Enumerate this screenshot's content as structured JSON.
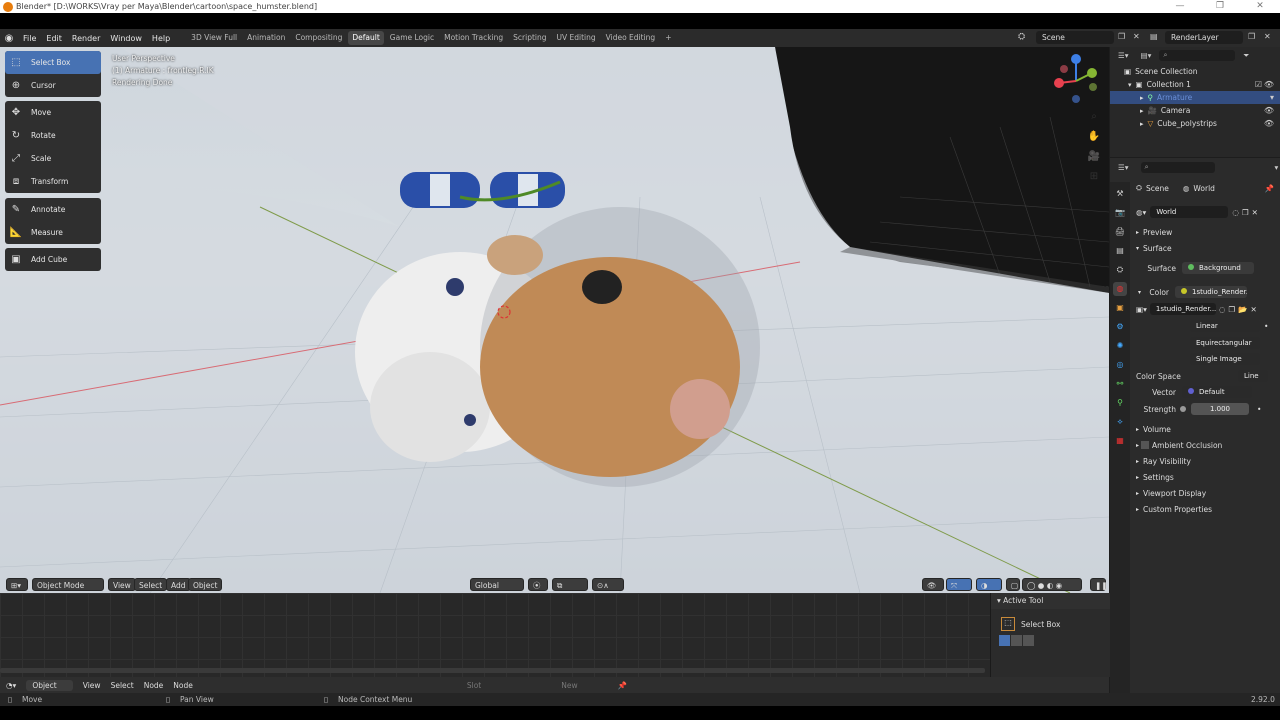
{
  "titlebar": {
    "text": "Blender* [D:\\WORKS\\Vray per Maya\\Blender\\cartoon\\space_humster.blend]",
    "minimize": "—",
    "maximize": "❐",
    "close": "✕"
  },
  "topbar": {
    "menu": [
      "File",
      "Edit",
      "Render",
      "Window",
      "Help"
    ],
    "workspaces": [
      "3D View Full",
      "Animation",
      "Compositing",
      "Default",
      "Game Logic",
      "Motion Tracking",
      "Scripting",
      "UV Editing",
      "Video Editing"
    ],
    "active_workspace": "Default",
    "add_tab": "+",
    "scene": "Scene",
    "view_layer": "RenderLayer"
  },
  "viewport": {
    "info": [
      "User Perspective",
      "(1) Armature : frontleg.R.IK",
      "Rendering Done"
    ],
    "tools": [
      "Select Box",
      "Cursor",
      "Move",
      "Rotate",
      "Scale",
      "Transform",
      "Annotate",
      "Measure",
      "Add Cube"
    ],
    "active_tool": "Select Box",
    "header": {
      "mode": "Object Mode",
      "view": "View",
      "select": "Select",
      "add": "Add",
      "object": "Object",
      "orientation": "Global"
    },
    "gizmo_axes": {
      "x": "X",
      "y": "Y",
      "z": "Z"
    },
    "colors": {
      "x_axis": "#e8414f",
      "y_axis": "#86b633",
      "z_axis": "#3d7fe6"
    }
  },
  "node_editor": {
    "header": {
      "type": "Object",
      "view": "View",
      "select": "Select",
      "add": "Node",
      "node": "Node",
      "slot": "Slot",
      "new": "New"
    }
  },
  "active_tool_panel": {
    "title": "Active Tool",
    "tool": "Select Box"
  },
  "statusbar": {
    "left": "Move",
    "middle": "Pan View",
    "right": "Node Context Menu",
    "version": "2.92.0"
  },
  "outliner": {
    "root": "Scene Collection",
    "items": [
      {
        "name": "Collection 1",
        "level": 1
      },
      {
        "name": "Armature",
        "level": 2,
        "selected": true
      },
      {
        "name": "Camera",
        "level": 2
      },
      {
        "name": "Cube_polystrips",
        "level": 2
      }
    ]
  },
  "properties": {
    "breadcrumb": {
      "scene": "Scene",
      "world": "World"
    },
    "world_name": "World",
    "panels": {
      "preview": "Preview",
      "surface": "Surface"
    },
    "surface": {
      "label": "Surface",
      "value": "Background"
    },
    "color": {
      "label": "Color",
      "value": "1studio_Render..."
    },
    "image": {
      "name": "1studio_Render...",
      "interpolation": "Linear",
      "projection": "Equirectangular",
      "source": "Single Image"
    },
    "color_space": {
      "label": "Color Space",
      "value": "Line"
    },
    "vector": {
      "label": "Vector",
      "value": "Default"
    },
    "strength": {
      "label": "Strength",
      "value": "1.000"
    },
    "collapsed": [
      "Volume",
      "Ambient Occlusion",
      "Ray Visibility",
      "Settings",
      "Viewport Display",
      "Custom Properties"
    ]
  }
}
